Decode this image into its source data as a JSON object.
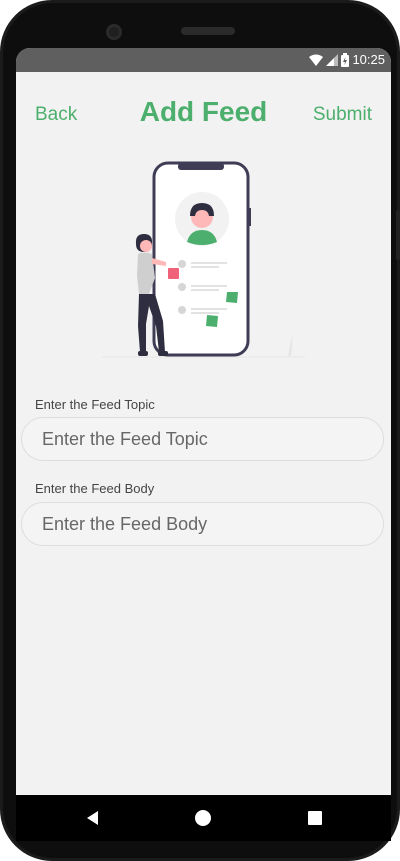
{
  "status_bar": {
    "time": "10:25",
    "icons": [
      "wifi-icon",
      "signal-icon",
      "battery-icon"
    ]
  },
  "header": {
    "back_label": "Back",
    "title": "Add Feed",
    "submit_label": "Submit"
  },
  "form": {
    "topic_label": "Enter the Feed Topic",
    "topic_placeholder": "Enter the Feed Topic",
    "topic_value": "",
    "body_label": "Enter the Feed Body",
    "body_placeholder": "Enter the Feed Body",
    "body_value": ""
  },
  "nav_bar": {
    "buttons": [
      "back-triangle-icon",
      "home-circle-icon",
      "recents-square-icon"
    ]
  },
  "colors": {
    "accent": "#4caf6d",
    "screen_bg": "#f2f2f2",
    "status_bar": "#5f5f5f",
    "illustration_pink": "#f0617a",
    "illustration_dark": "#3f3d56"
  }
}
